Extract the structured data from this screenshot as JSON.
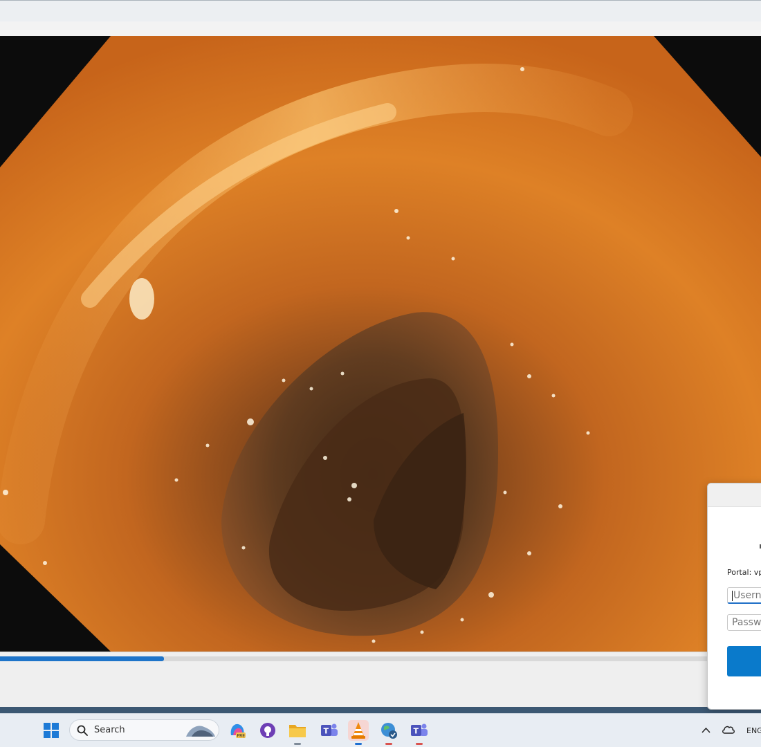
{
  "window": {
    "title": "",
    "progress_percent": 21.5
  },
  "video": {
    "scene": "endoscopy-frame"
  },
  "dialog": {
    "portal_label": "Portal: vp",
    "username_placeholder": "Userna",
    "password_placeholder": "Passwo"
  },
  "taskbar": {
    "search_label": "Search",
    "tray_language": "ENG",
    "icons": [
      "windows-start-icon",
      "search-icon",
      "copilot-icon",
      "github-icon",
      "file-explorer-icon",
      "teams-icon",
      "vlc-icon",
      "browser-icon",
      "teams-alt-icon"
    ]
  },
  "colors": {
    "accent": "#1e74c9",
    "taskbar": "#e8edf3",
    "tissue": "#d9782a"
  }
}
